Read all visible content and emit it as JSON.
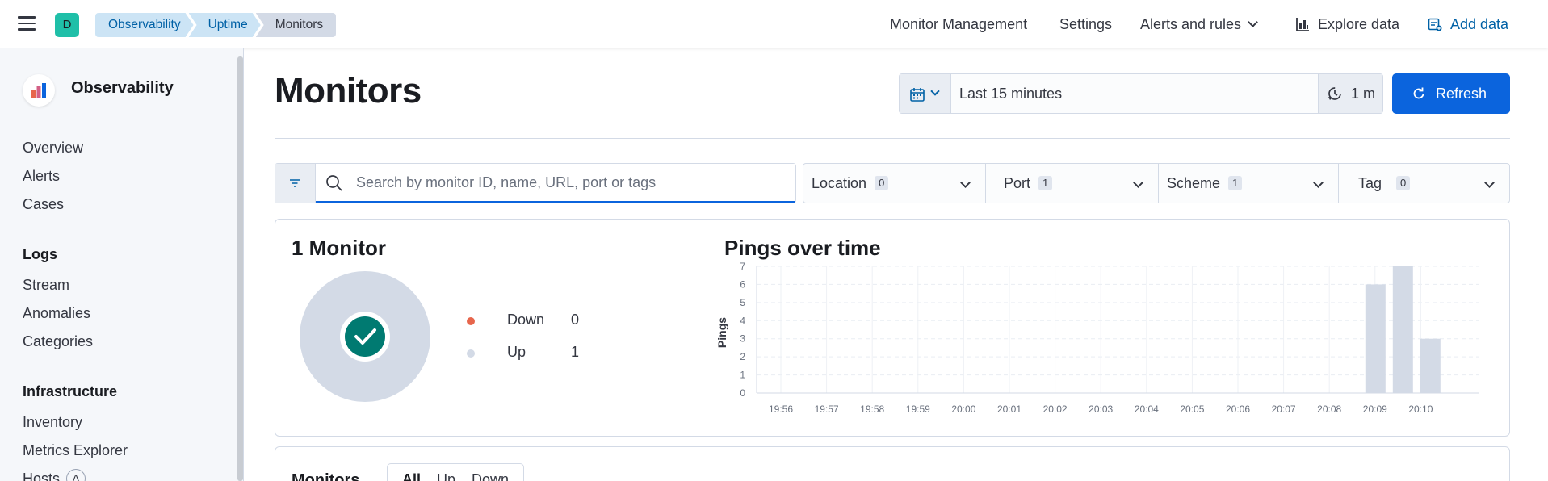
{
  "header": {
    "space_initial": "D",
    "breadcrumbs": [
      "Observability",
      "Uptime",
      "Monitors"
    ],
    "nav": {
      "monitor_management": "Monitor Management",
      "settings": "Settings",
      "alerts_rules": "Alerts and rules",
      "explore_data": "Explore data",
      "add_data": "Add data"
    }
  },
  "sidebar": {
    "title": "Observability",
    "items_top": [
      "Overview",
      "Alerts",
      "Cases"
    ],
    "logs_heading": "Logs",
    "logs_items": [
      "Stream",
      "Anomalies",
      "Categories"
    ],
    "infra_heading": "Infrastructure",
    "infra_items": [
      "Inventory",
      "Metrics Explorer",
      "Hosts"
    ],
    "hosts_badge": "Ʌ"
  },
  "main": {
    "title": "Monitors",
    "date_range": "Last 15 minutes",
    "refresh_interval": "1 m",
    "refresh_label": "Refresh",
    "search_placeholder": "Search by monitor ID, name, URL, port or tags",
    "filters": [
      {
        "label": "Location",
        "count": "0"
      },
      {
        "label": "Port",
        "count": "1"
      },
      {
        "label": "Scheme",
        "count": "1"
      },
      {
        "label": "Tag",
        "count": "0"
      }
    ],
    "summary": {
      "title": "1 Monitor",
      "down_label": "Down",
      "down_value": "0",
      "up_label": "Up",
      "up_value": "1",
      "down_color": "#e7664c",
      "up_color": "#d3dae6",
      "check_color": "#007a71"
    },
    "monitors_panel": {
      "title": "Monitors",
      "segments": [
        "All",
        "Up",
        "Down"
      ]
    }
  },
  "chart_data": {
    "type": "bar",
    "title": "Pings over time",
    "ylabel": "Pings",
    "xlabel": "",
    "ylim": [
      0,
      7
    ],
    "yticks": [
      0,
      1,
      2,
      3,
      4,
      5,
      6,
      7
    ],
    "categories": [
      "19:56",
      "19:57",
      "19:58",
      "19:59",
      "20:00",
      "20:01",
      "20:02",
      "20:03",
      "20:04",
      "20:05",
      "20:06",
      "20:07",
      "20:08",
      "20:09",
      "20:10"
    ],
    "series": [
      {
        "x": [
          "20:09",
          "20:09:30",
          "20:10"
        ],
        "values": [
          6,
          7,
          3
        ]
      }
    ],
    "bar_color": "#d3dae6",
    "grid": true
  }
}
